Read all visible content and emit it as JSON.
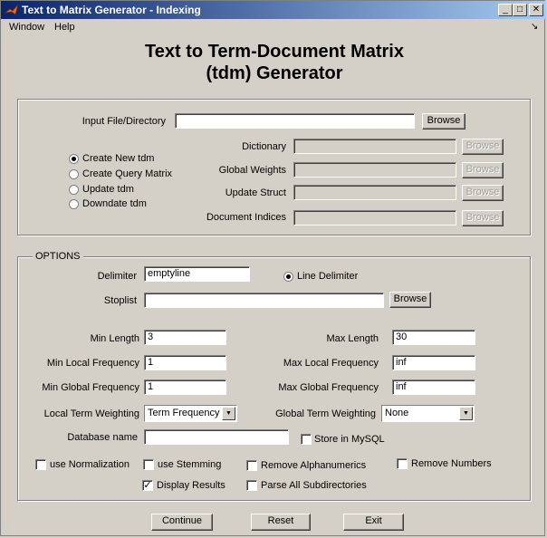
{
  "window": {
    "title": "Text to Matrix Generator - Indexing",
    "min_glyph": "_",
    "max_glyph": "□",
    "close_glyph": "✕"
  },
  "menu": {
    "items": [
      "Window",
      "Help"
    ],
    "corner_arrow": "↘"
  },
  "heading": {
    "line1": "Text to Term-Document Matrix",
    "line2": "(tdm) Generator"
  },
  "input_section": {
    "input_label": "Input File/Directory",
    "input_value": "",
    "browse": "Browse",
    "modes": [
      {
        "label": "Create New tdm",
        "selected": true
      },
      {
        "label": "Create Query Matrix",
        "selected": false
      },
      {
        "label": "Update tdm",
        "selected": false
      },
      {
        "label": "Downdate tdm",
        "selected": false
      }
    ],
    "fields": [
      {
        "label": "Dictionary",
        "value": "",
        "browse": "Browse"
      },
      {
        "label": "Global Weights",
        "value": "",
        "browse": "Browse"
      },
      {
        "label": "Update Struct",
        "value": "",
        "browse": "Browse"
      },
      {
        "label": "Document Indices",
        "value": "",
        "browse": "Browse"
      }
    ]
  },
  "options": {
    "title": "OPTIONS",
    "delimiter_label": "Delimiter",
    "delimiter_value": "emptyline",
    "line_delimiter_label": "Line Delimiter",
    "line_delimiter_selected": true,
    "stoplist_label": "Stoplist",
    "stoplist_value": "",
    "stoplist_browse": "Browse",
    "min_length_label": "Min Length",
    "min_length": "3",
    "max_length_label": "Max Length",
    "max_length": "30",
    "min_local_label": "Min Local Frequency",
    "min_local": "1",
    "max_local_label": "Max Local Frequency",
    "max_local": "inf",
    "min_global_label": "Min Global Frequency",
    "min_global": "1",
    "max_global_label": "Max Global Frequency",
    "max_global": "inf",
    "local_weighting_label": "Local Term Weighting",
    "local_weighting": "Term Frequency",
    "global_weighting_label": "Global Term Weighting",
    "global_weighting": "None",
    "db_label": "Database name",
    "db_value": "",
    "store_mysql_label": "Store in MySQL",
    "store_mysql": false,
    "checks": {
      "normalization": {
        "label": "use Normalization",
        "checked": false
      },
      "stemming": {
        "label": "use Stemming",
        "checked": false
      },
      "remove_alnum": {
        "label": "Remove Alphanumerics",
        "checked": false
      },
      "remove_numbers": {
        "label": "Remove Numbers",
        "checked": false
      },
      "display_results": {
        "label": "Display Results",
        "checked": true
      },
      "parse_subdirs": {
        "label": "Parse All Subdirectories",
        "checked": false
      }
    },
    "check_glyph": "✓",
    "dropdown_glyph": "▼"
  },
  "actions": {
    "continue": "Continue",
    "reset": "Reset",
    "exit": "Exit"
  },
  "colors": {
    "face": "#d4d0c8",
    "title_start": "#0a246a",
    "title_end": "#a6caf0"
  }
}
